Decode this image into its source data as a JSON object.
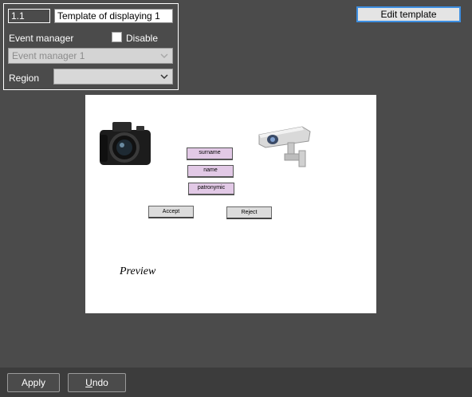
{
  "panel": {
    "id_value": "1.1",
    "name_value": "Template of displaying 1",
    "event_manager_label": "Event manager",
    "disable_label": "Disable",
    "disable_checked": false,
    "event_manager_select": "Event manager 1",
    "region_label": "Region",
    "region_select": ""
  },
  "toolbar": {
    "edit_template_label": "Edit template"
  },
  "canvas": {
    "fields": {
      "surname": "surname",
      "name": "name",
      "patronymic": "patronymic"
    },
    "accept_label": "Accept",
    "reject_label": "Reject",
    "preview_label": "Preview",
    "icons": [
      "camera-icon",
      "cctv-camera-icon"
    ]
  },
  "bottom": {
    "apply_label": "Apply",
    "undo_first": "U",
    "undo_rest": "ndo"
  },
  "colors": {
    "background": "#4b4b4b",
    "bottom_bar": "#3c3c3c",
    "field_fill": "#e2c9e6",
    "accent_border": "#3d8ee0"
  }
}
